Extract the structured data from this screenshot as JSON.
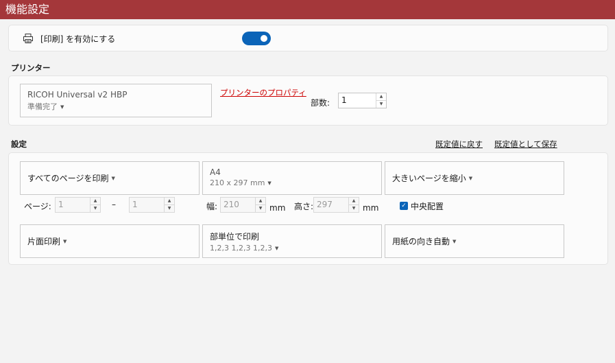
{
  "window": {
    "title": "機能設定"
  },
  "enable_print": {
    "label": "[印刷] を有効にする",
    "icon": "printer-icon",
    "enabled": true
  },
  "printer_section": {
    "label": "プリンター",
    "printer_name": "RICOH Universal v2 HBP",
    "printer_status": "準備完了",
    "properties_link": "プリンターのプロパティ",
    "copies_label": "部数:",
    "copies_value": "1"
  },
  "settings_section": {
    "label": "設定",
    "reset_link": "既定値に戻す",
    "save_link": "既定値として保存",
    "page_range": "すべてのページを印刷",
    "paper_size": "A4",
    "paper_dims": "210 x 297 mm",
    "scaling": "大きいページを縮小",
    "pages_label": "ページ:",
    "page_from": "1",
    "page_dash": "–",
    "page_to": "1",
    "width_label": "幅:",
    "width_value": "210",
    "width_unit": "mm",
    "height_label": "高さ:",
    "height_value": "297",
    "height_unit": "mm",
    "center_label": "中央配置",
    "center_checked": true,
    "duplex": "片面印刷",
    "collate": "部単位で印刷",
    "collate_detail": "1,2,3 1,2,3 1,2,3",
    "orientation": "用紙の向き自動"
  },
  "colors": {
    "title_bar": "#a4373a",
    "accent": "#0b64b8",
    "link_red": "#cc0000"
  }
}
